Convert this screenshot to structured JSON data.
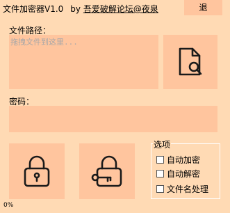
{
  "header": {
    "app_title": "文件加密器V1.0",
    "by": "by",
    "author": "吾爱破解论坛@夜泉",
    "exit_label": "退"
  },
  "file": {
    "label": "文件路径：",
    "placeholder": "拖拽文件到这里..."
  },
  "password": {
    "label": "密码："
  },
  "options": {
    "title": "选项",
    "items": [
      {
        "label": "自动加密",
        "checked": false
      },
      {
        "label": "自动解密",
        "checked": false
      },
      {
        "label": "文件名处理",
        "checked": false
      }
    ]
  },
  "status": {
    "progress": "0%"
  },
  "icons": {
    "browse": "file-search-icon",
    "encrypt": "lock-icon",
    "decrypt": "unlock-key-icon"
  }
}
